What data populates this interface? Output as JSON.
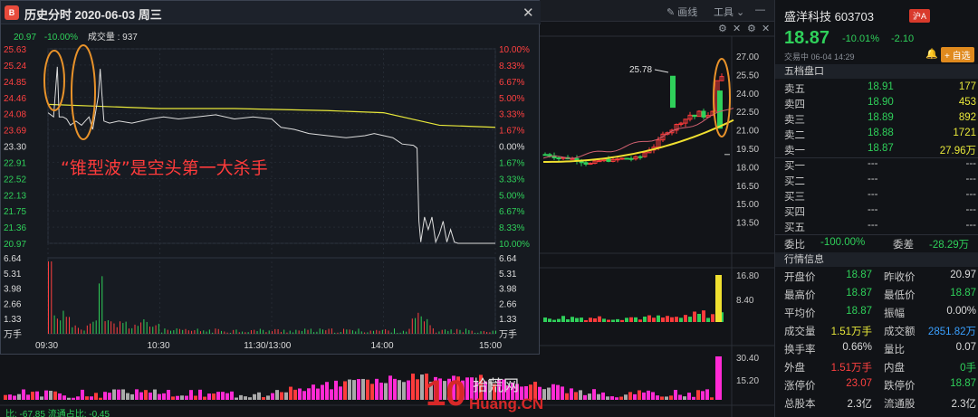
{
  "bg": {
    "toolbar": {
      "draw_label": "画线",
      "tools_label": "工具"
    },
    "kline_axis": [
      "27.00",
      "25.50",
      "24.00",
      "22.50",
      "21.00",
      "19.50",
      "18.00",
      "16.50",
      "15.00",
      "13.50"
    ],
    "kline_peak": "25.78",
    "vol_axis": [
      "16.80",
      "8.40"
    ],
    "vol2_axis": [
      "30.40",
      "15.20"
    ],
    "bottom_left": "比: -67.85  流通占比: -0.45"
  },
  "popup": {
    "title": "历史分时  2020-06-03 周三",
    "logo": "B",
    "info": {
      "price": "20.97",
      "pct": "-10.00%",
      "vol_label": "成交量 : 937"
    },
    "left_axis": [
      "25.63",
      "25.24",
      "24.85",
      "24.46",
      "24.08",
      "23.69",
      "23.30",
      "22.91",
      "22.52",
      "22.13",
      "21.75",
      "21.36",
      "20.97"
    ],
    "right_axis": [
      "10.00%",
      "8.33%",
      "6.67%",
      "5.00%",
      "3.33%",
      "1.67%",
      "0.00%",
      "1.67%",
      "3.33%",
      "5.00%",
      "6.67%",
      "8.33%",
      "10.00%"
    ],
    "vol_axis": [
      "6.64",
      "5.31",
      "3.98",
      "2.66",
      "1.33",
      "万手"
    ],
    "time_axis": [
      "09:30",
      "10:30",
      "11:30/13:00",
      "14:00",
      "15:00"
    ],
    "caption": "“锥型波”是空头第一大杀手",
    "price_line": [
      [
        0,
        24.1
      ],
      [
        3,
        24.0
      ],
      [
        4,
        24.6
      ],
      [
        5,
        25.2
      ],
      [
        6,
        24.0
      ],
      [
        8,
        24.0
      ],
      [
        10,
        23.95
      ],
      [
        12,
        23.8
      ],
      [
        15,
        23.9
      ],
      [
        18,
        23.8
      ],
      [
        22,
        24.0
      ],
      [
        24,
        23.7
      ],
      [
        27,
        24.5
      ],
      [
        28,
        25.15
      ],
      [
        29,
        24.5
      ],
      [
        30,
        23.9
      ],
      [
        33,
        23.85
      ],
      [
        38,
        23.9
      ],
      [
        45,
        23.85
      ],
      [
        55,
        23.95
      ],
      [
        62,
        24.0
      ],
      [
        70,
        23.95
      ],
      [
        80,
        24.0
      ],
      [
        90,
        24.05
      ],
      [
        100,
        23.95
      ],
      [
        110,
        24.0
      ],
      [
        120,
        23.95
      ],
      [
        125,
        23.75
      ],
      [
        132,
        23.7
      ],
      [
        140,
        23.6
      ],
      [
        150,
        23.55
      ],
      [
        160,
        23.5
      ],
      [
        170,
        23.55
      ],
      [
        175,
        23.6
      ],
      [
        185,
        23.5
      ],
      [
        190,
        23.35
      ],
      [
        196,
        23.32
      ],
      [
        198,
        23.25
      ],
      [
        199,
        21.5
      ],
      [
        200,
        21.0
      ],
      [
        201,
        21.3
      ],
      [
        202,
        21.6
      ],
      [
        204,
        21.3
      ],
      [
        206,
        21.6
      ],
      [
        208,
        21.0
      ],
      [
        210,
        21.2
      ],
      [
        212,
        21.5
      ],
      [
        214,
        21.0
      ],
      [
        216,
        21.3
      ],
      [
        218,
        21.0
      ],
      [
        220,
        20.97
      ],
      [
        240,
        20.97
      ]
    ],
    "avg_line": [
      [
        0,
        24.3
      ],
      [
        30,
        24.25
      ],
      [
        60,
        24.2
      ],
      [
        100,
        24.2
      ],
      [
        150,
        24.15
      ],
      [
        180,
        24.1
      ],
      [
        200,
        23.9
      ],
      [
        210,
        23.8
      ],
      [
        240,
        23.75
      ]
    ]
  },
  "quote": {
    "name": "盛洋科技 603703",
    "market_tag": "沪A",
    "price": "18.87",
    "pct": "-10.01%",
    "change": "-2.10",
    "status": "交易中  06-04  14:29",
    "fav_label": "自选",
    "book_title": "五档盘口",
    "asks": [
      {
        "label": "卖五",
        "price": "18.91",
        "vol": "177"
      },
      {
        "label": "卖四",
        "price": "18.90",
        "vol": "453"
      },
      {
        "label": "卖三",
        "price": "18.89",
        "vol": "892"
      },
      {
        "label": "卖二",
        "price": "18.88",
        "vol": "1721"
      },
      {
        "label": "卖一",
        "price": "18.87",
        "vol": "27.96万"
      }
    ],
    "bids": [
      {
        "label": "买一",
        "price": "---",
        "vol": "---"
      },
      {
        "label": "买二",
        "price": "---",
        "vol": "---"
      },
      {
        "label": "买三",
        "price": "---",
        "vol": "---"
      },
      {
        "label": "买四",
        "price": "---",
        "vol": "---"
      },
      {
        "label": "买五",
        "price": "---",
        "vol": "---"
      }
    ],
    "ratio": {
      "l1": "委比",
      "v1": "-100.00%",
      "l2": "委差",
      "v2": "-28.29万"
    },
    "info_title": "行情信息",
    "stats": [
      {
        "l1": "开盘价",
        "v1": "18.87",
        "c1": "green",
        "l2": "昨收价",
        "v2": "20.97",
        "c2": "white"
      },
      {
        "l1": "最高价",
        "v1": "18.87",
        "c1": "green",
        "l2": "最低价",
        "v2": "18.87",
        "c2": "green"
      },
      {
        "l1": "平均价",
        "v1": "18.87",
        "c1": "green",
        "l2": "振幅",
        "v2": "0.00%",
        "c2": "white"
      },
      {
        "l1": "成交量",
        "v1": "1.51万手",
        "c1": "yellow",
        "l2": "成交额",
        "v2": "2851.82万",
        "c2": "blue"
      },
      {
        "l1": "换手率",
        "v1": "0.66%",
        "c1": "white",
        "l2": "量比",
        "v2": "0.07",
        "c2": "white"
      },
      {
        "l1": "外盘",
        "v1": "1.51万手",
        "c1": "red",
        "l2": "内盘",
        "v2": "0手",
        "c2": "green"
      },
      {
        "l1": "涨停价",
        "v1": "23.07",
        "c1": "red",
        "l2": "跌停价",
        "v2": "18.87",
        "c2": "green"
      },
      {
        "l1": "总股本",
        "v1": "2.3亿",
        "c1": "white",
        "l2": "流通股",
        "v2": "2.3亿",
        "c2": "white"
      }
    ]
  },
  "watermark": {
    "num": "10",
    "cn": "拾荒网",
    "en": "Huang.CN"
  }
}
